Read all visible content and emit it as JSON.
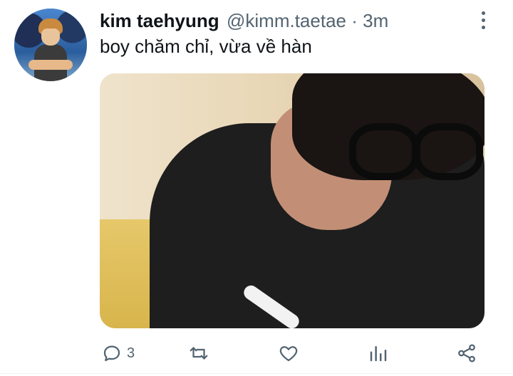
{
  "tweet": {
    "author_name": "kim taehyung",
    "handle": "@kimm.taetae",
    "separator": "·",
    "time": "3m",
    "text": "boy chăm chỉ, vừa về hàn"
  },
  "actions": {
    "reply_count": "3",
    "icons": [
      "reply-icon",
      "retweet-icon",
      "like-icon",
      "analytics-icon",
      "share-icon"
    ]
  },
  "colors": {
    "text_primary": "#0f1419",
    "text_secondary": "#536471",
    "background": "#ffffff"
  }
}
